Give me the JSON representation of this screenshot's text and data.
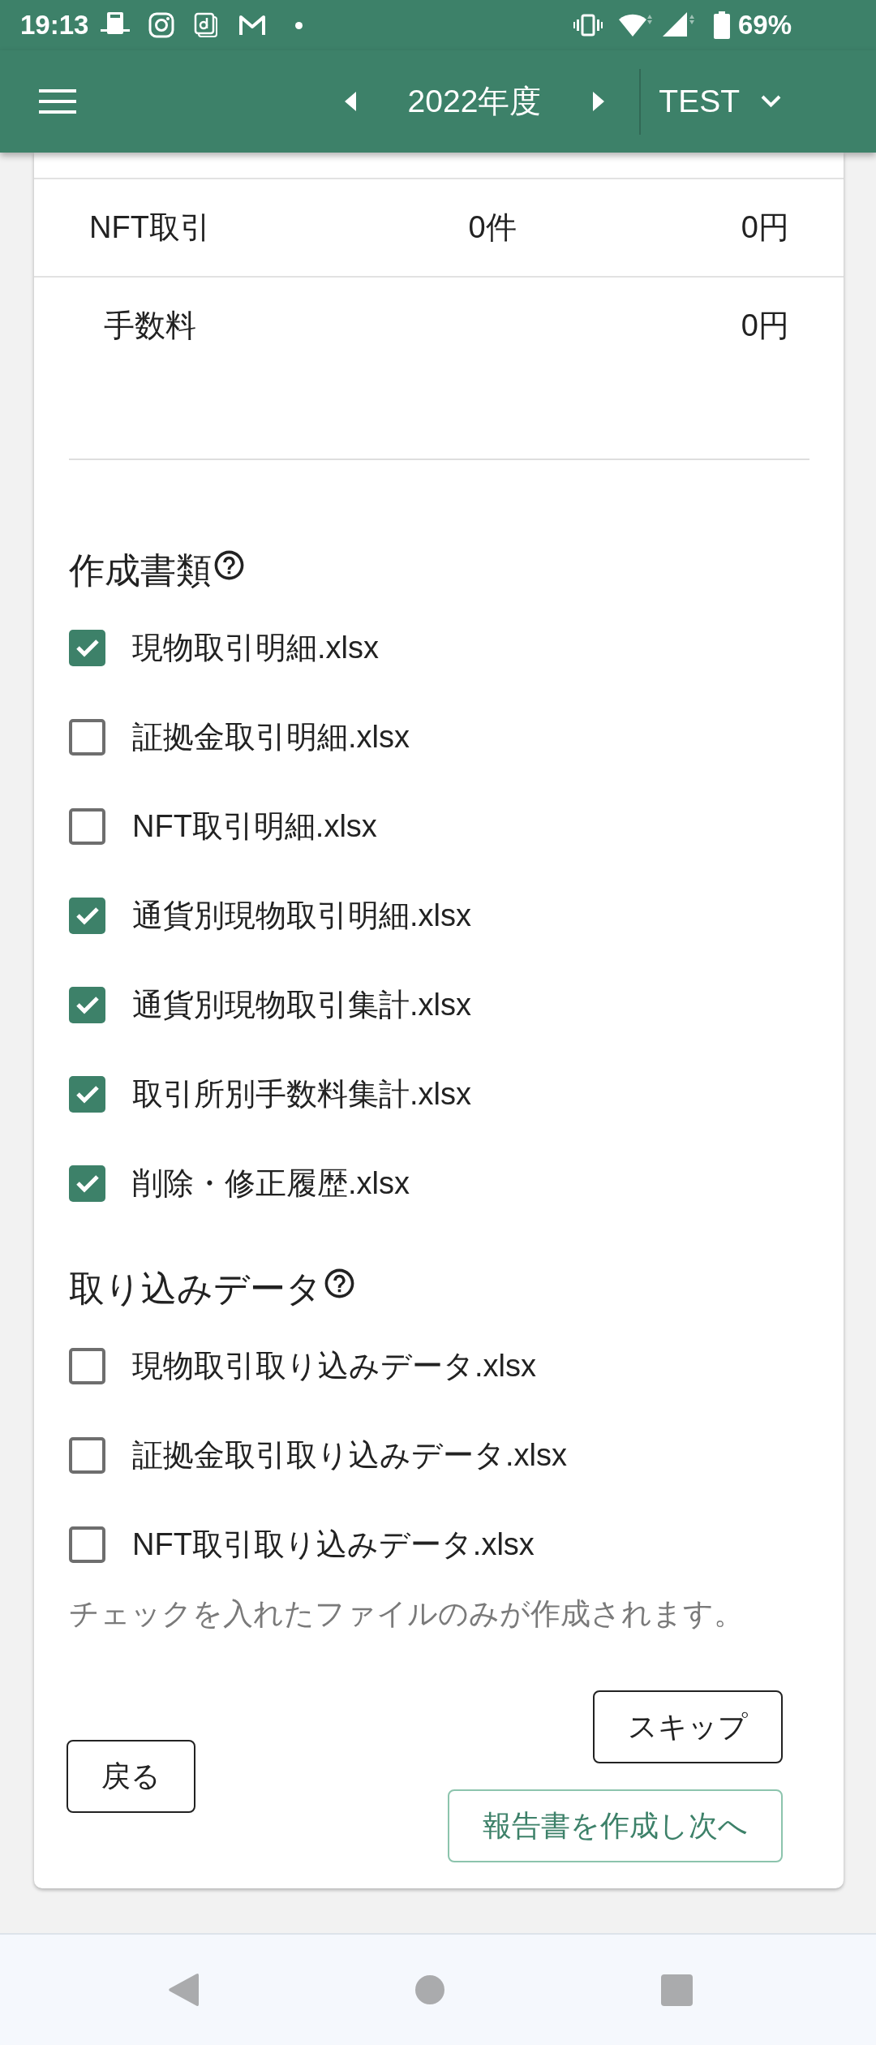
{
  "status_bar": {
    "time": "19:13",
    "battery": "69%"
  },
  "app_bar": {
    "period": "2022年度",
    "account": "TEST"
  },
  "summary_table": {
    "rows": [
      {
        "label": "NFT取引",
        "count": "0件",
        "amount": "0円"
      },
      {
        "label": "手数料",
        "amount": "0円"
      }
    ]
  },
  "sections": [
    {
      "title": "作成書類",
      "items": [
        {
          "label": "現物取引明細.xlsx",
          "checked": true
        },
        {
          "label": "証拠金取引明細.xlsx",
          "checked": false
        },
        {
          "label": "NFT取引明細.xlsx",
          "checked": false
        },
        {
          "label": "通貨別現物取引明細.xlsx",
          "checked": true
        },
        {
          "label": "通貨別現物取引集計.xlsx",
          "checked": true
        },
        {
          "label": "取引所別手数料集計.xlsx",
          "checked": true
        },
        {
          "label": "削除・修正履歴.xlsx",
          "checked": true
        }
      ]
    },
    {
      "title": "取り込みデータ",
      "items": [
        {
          "label": "現物取引取り込みデータ.xlsx",
          "checked": false
        },
        {
          "label": "証拠金取引取り込みデータ.xlsx",
          "checked": false
        },
        {
          "label": "NFT取引取り込みデータ.xlsx",
          "checked": false
        }
      ]
    }
  ],
  "note": "チェックを入れたファイルのみが作成されます。",
  "buttons": {
    "skip": "スキップ",
    "back": "戻る",
    "create": "報告書を作成し次へ"
  }
}
